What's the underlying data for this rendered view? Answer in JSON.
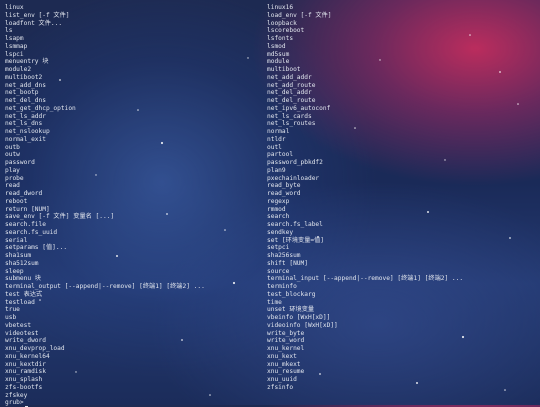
{
  "terminal": {
    "left_column": [
      "linux",
      "list_env [-f 文件]",
      "loadfont 文件...",
      "ls",
      "lsapm",
      "lsmmap",
      "lspci",
      "menuentry 块",
      "module2",
      "multiboot2",
      "net_add_dns",
      "net_bootp",
      "net_del_dns",
      "net_get_dhcp_option",
      "net_ls_addr",
      "net_ls_dns",
      "net_nslookup",
      "normal_exit",
      "outb",
      "outw",
      "password",
      "play",
      "probe",
      "read",
      "read_dword",
      "reboot",
      "return [NUM]",
      "save_env [-f 文件] 变量名 [...]",
      "search.file",
      "search.fs_uuid",
      "serial",
      "setparams [值]...",
      "sha1sum",
      "sha512sum",
      "sleep",
      "submenu 块",
      "terminal_output [--append|--remove] [终端1] [终端2] ...",
      "test 表达式",
      "testload",
      "true",
      "usb",
      "vbetest",
      "videotest",
      "write_dword",
      "xnu_devprop_load",
      "xnu_kernel64",
      "xnu_kextdir",
      "xnu_ramdisk",
      "xnu_splash",
      "zfs-bootfs",
      "zfskey",
      "grub>"
    ],
    "right_column": [
      "linux16",
      "load_env [-f 文件]",
      "loopback",
      "lscoreboot",
      "lsfonts",
      "lsmod",
      "md5sum",
      "module",
      "multiboot",
      "net_add_addr",
      "net_add_route",
      "net_del_addr",
      "net_del_route",
      "net_ipv6_autoconf",
      "net_ls_cards",
      "net_ls_routes",
      "normal",
      "ntldr",
      "outl",
      "partool",
      "password_pbkdf2",
      "plan9",
      "pxechainloader",
      "read_byte",
      "read_word",
      "regexp",
      "rmmod",
      "search",
      "search.fs_label",
      "sendkey",
      "set [环境变量=值]",
      "setpci",
      "sha256sum",
      "shift [NUM]",
      "source",
      "terminal_input [--append|--remove] [终端1] [终端2] ...",
      "terminfo",
      "test_blockarg",
      "time",
      "unset 环境变量",
      "vbeinfo [WxH[xD]]",
      "videoinfo [WxH[xD]]",
      "write_byte",
      "write_word",
      "xnu_kernel",
      "xnu_kext",
      "xnu_mkext",
      "xnu_resume",
      "xnu_uuid",
      "zfsinfo"
    ]
  },
  "colors": {
    "text": "#e2e6ee",
    "magenta_glow": "#d62d5f",
    "background": "#1d2a52"
  }
}
